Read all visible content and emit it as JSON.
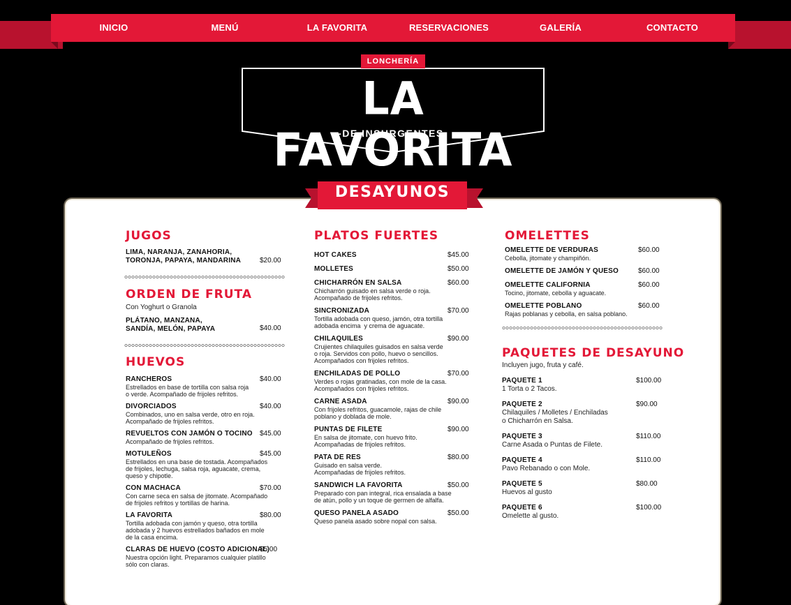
{
  "nav": {
    "items": [
      "INICIO",
      "MENÚ",
      "LA FAVORITA",
      "RESERVACIONES",
      "GALERÍA",
      "CONTACTO"
    ]
  },
  "logo": {
    "top": "LONCHERÍA",
    "title": "LA FAVORITA",
    "subtitle": "-DE INSURGENTES-"
  },
  "section": {
    "title": "DESAYUNOS"
  },
  "col1": {
    "jugos": {
      "heading": "JUGOS",
      "items": [
        {
          "name": "LIMA, NARANJA, ZANAHORIA,\nTORONJA, PAPAYA, MANDARINA",
          "price": "$20.00"
        }
      ]
    },
    "fruta": {
      "heading": "ORDEN DE FRUTA",
      "note": "Con Yoghurt o Granola",
      "items": [
        {
          "name": "PLÁTANO, MANZANA,\nSANDÍA, MELÓN, PAPAYA",
          "price": "$40.00"
        }
      ]
    },
    "huevos": {
      "heading": "HUEVOS",
      "items": [
        {
          "name": "RANCHEROS",
          "desc": "Estrellados en base de tortilla con salsa roja\no verde. Acompañado de frijoles refritos.",
          "price": "$40.00"
        },
        {
          "name": "DIVORCIADOS",
          "desc": "Combinados, uno en salsa verde, otro en roja.\nAcompañado de frijoles refritos.",
          "price": "$40.00"
        },
        {
          "name": "REVUELTOS CON JAMÓN O TOCINO",
          "desc": "Acompañado de frijoles refritos.",
          "price": "$45.00"
        },
        {
          "name": "MOTULEÑOS",
          "desc": "Estrellados en una base de tostada. Acompañados\nde frijoles, lechuga, salsa roja, aguacate, crema,\nqueso y chipotle.",
          "price": "$45.00"
        },
        {
          "name": "CON MACHACA",
          "desc": "Con carne seca en salsa de jitomate. Acompañado\nde frijoles refritos y tortillas de harina.",
          "price": "$70.00"
        },
        {
          "name": "LA FAVORITA",
          "desc": "Tortilla adobada con jamón y queso, otra tortilla\nadobada y 2 huevos estrellados bañados en mole\nde la casa encima.",
          "price": "$80.00"
        },
        {
          "name": "CLARAS DE HUEVO (COSTO ADICIONAL)",
          "desc": "Nuestra opción light. Preparamos cualquier platillo\nsólo con claras.",
          "price": "$5.00"
        }
      ]
    }
  },
  "col2": {
    "heading": "PLATOS FUERTES",
    "items": [
      {
        "name": "HOT CAKES",
        "desc": "",
        "price": "$45.00"
      },
      {
        "name": "MOLLETES",
        "desc": "",
        "price": "$50.00"
      },
      {
        "name": "CHICHARRÓN EN SALSA",
        "desc": "Chicharrón guisado en salsa verde o roja.\nAcompañado de frijoles refritos.",
        "price": "$60.00"
      },
      {
        "name": "SINCRONIZADA",
        "desc": "Tortilla adobada con queso, jamón, otra tortilla\nadobada encima  y crema de aguacate.",
        "price": "$70.00"
      },
      {
        "name": "CHILAQUILES",
        "desc": "Crujientes chilaquiles guisados en salsa verde\no roja. Servidos con pollo, huevo o sencillos.\nAcompañados con frijoles refritos.",
        "price": "$90.00"
      },
      {
        "name": "ENCHILADAS DE POLLO",
        "desc": "Verdes o rojas gratinadas, con mole de la casa.\nAcompañados con frijoles refritos.",
        "price": "$70.00"
      },
      {
        "name": "CARNE ASADA",
        "desc": "Con frijoles refritos, guacamole, rajas de chile\npoblano y doblada de mole.",
        "price": "$90.00"
      },
      {
        "name": "PUNTAS DE FILETE",
        "desc": "En salsa de jitomate, con huevo frito.\nAcompañadas de frijoles refritos.",
        "price": "$90.00"
      },
      {
        "name": "PATA DE RES",
        "desc": "Guisado en salsa verde.\nAcompañadas de frijoles refritos.",
        "price": "$80.00"
      },
      {
        "name": "SANDWICH LA FAVORITA",
        "desc": "Preparado con pan integral, rica ensalada a base\nde atún, pollo y un toque de germen de alfalfa.",
        "price": "$50.00"
      },
      {
        "name": "QUESO PANELA ASADO",
        "desc": "Queso panela asado sobre nopal con salsa.",
        "price": "$50.00"
      }
    ]
  },
  "col3": {
    "omelettes": {
      "heading": "OMELETTES",
      "items": [
        {
          "name": "OMELETTE DE VERDURAS",
          "desc": "Cebolla, jitomate y champiñón.",
          "price": "$60.00"
        },
        {
          "name": "OMELETTE DE JAMÓN Y QUESO",
          "desc": "",
          "price": "$60.00"
        },
        {
          "name": "OMELETTE CALIFORNIA",
          "desc": "Tocino, jitomate, cebolla y aguacate.",
          "price": "$60.00"
        },
        {
          "name": "OMELETTE POBLANO",
          "desc": "Rajas poblanas y cebolla, en salsa poblano.",
          "price": "$60.00"
        }
      ]
    },
    "paquetes": {
      "heading": "PAQUETES DE DESAYUNO",
      "note": "Incluyen jugo, fruta y café.",
      "items": [
        {
          "name": "PAQUETE 1",
          "desc": "1 Torta o 2 Tacos.",
          "price": "$100.00"
        },
        {
          "name": "PAQUETE 2",
          "desc": "Chilaquiles / Molletes / Enchiladas\no Chicharrón en Salsa.",
          "price": "$90.00"
        },
        {
          "name": "PAQUETE 3",
          "desc": "Carne Asada o Puntas de Filete.",
          "price": "$110.00"
        },
        {
          "name": "PAQUETE 4",
          "desc": "Pavo Rebanado o con Mole.",
          "price": "$110.00"
        },
        {
          "name": "PAQUETE 5",
          "desc": "Huevos al gusto",
          "price": "$80.00"
        },
        {
          "name": "PAQUETE 6",
          "desc": "Omelette al gusto.",
          "price": "$100.00"
        }
      ]
    }
  }
}
